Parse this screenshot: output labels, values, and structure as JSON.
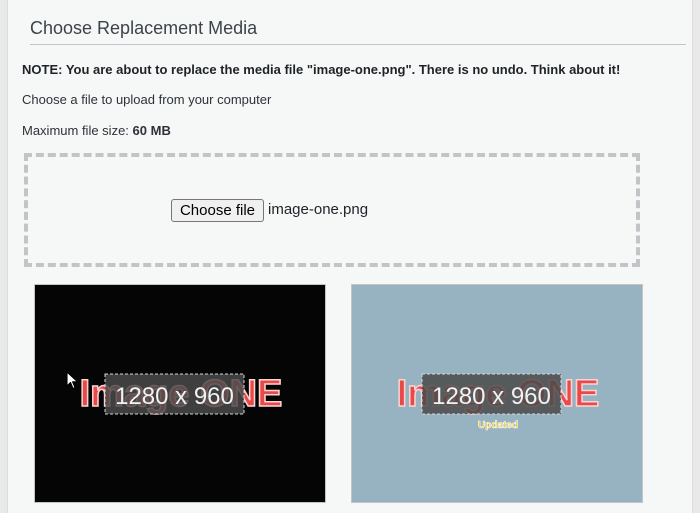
{
  "section": {
    "title": "Choose Replacement Media"
  },
  "note": "NOTE: You are about to replace the media file \"image-one.png\". There is no undo. Think about it!",
  "instruction": "Choose a file to upload from your computer",
  "max_size": {
    "label": "Maximum file size:",
    "value": "60 MB"
  },
  "upload": {
    "button_label": "Choose file",
    "file_name": "image-one.png"
  },
  "previews": {
    "current": {
      "background": "#050505",
      "image_text": "Image ONE",
      "dimension_label": "1280 x 960"
    },
    "replacement": {
      "background": "#97b3c1",
      "image_text": "Image ONE",
      "dimension_label": "1280 x 960",
      "badge": "Updated"
    }
  },
  "colors": {
    "image_text": "#e84a4a",
    "badge": "#f0c000",
    "panel": "#f6f7f7"
  },
  "icons": [
    "mouse-cursor-icon"
  ]
}
